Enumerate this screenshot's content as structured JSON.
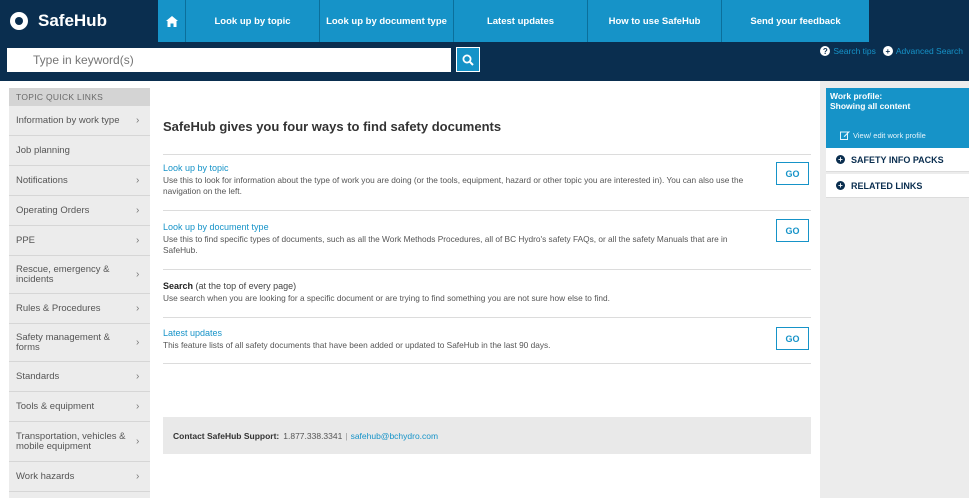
{
  "header": {
    "brand": "SafeHub",
    "nav": [
      "Look up by topic",
      "Look up by document type",
      "Latest updates",
      "How to use SafeHub",
      "Send your feedback"
    ]
  },
  "search": {
    "placeholder": "Type in keyword(s)",
    "tips_label": "Search tips",
    "advanced_label": "Advanced Search"
  },
  "sidebar": {
    "header": "TOPIC QUICK LINKS",
    "items": [
      "Information by work type",
      "Job planning",
      "Notifications",
      "Operating Orders",
      "PPE",
      "Rescue, emergency & incidents",
      "Rules & Procedures",
      "Safety management & forms",
      "Standards",
      "Tools & equipment",
      "Transportation, vehicles & mobile equipment",
      "Work hazards"
    ]
  },
  "main": {
    "title": "SafeHub gives you four ways to find safety documents",
    "sections": [
      {
        "title": "Look up by topic",
        "desc": "Use this to look for information about the type of work you are doing (or the tools, equipment, hazard or other topic you are interested in). You can also use the navigation on the left.",
        "button": "GO"
      },
      {
        "title": "Look up by document type",
        "desc": "Use this to find specific types of documents, such as all the Work Methods Procedures, all of BC Hydro's safety FAQs, or all the safety Manuals that are in SafeHub.",
        "button": "GO"
      },
      {
        "title": "Search",
        "title_suffix": "(at the top of every page)",
        "desc": "Use search when you are looking for a specific document or are trying to find something you are not sure how else to find."
      },
      {
        "title": "Latest updates",
        "desc": "This feature lists of all safety documents that have been added or updated to SafeHub in the last 90 days.",
        "button": "GO"
      }
    ],
    "contact": {
      "label": "Contact SafeHub Support:",
      "phone": "1.877.338.3341",
      "separator": "|",
      "email": "safehub@bchydro.com"
    }
  },
  "rightpanel": {
    "work_profile_label": "Work profile:",
    "work_profile_value": "Showing all content",
    "edit_link": "View/ edit work profile",
    "items": [
      "SAFETY INFO PACKS",
      "RELATED LINKS"
    ]
  },
  "colors": {
    "navy": "#0a2e4f",
    "accent": "#1693c8",
    "sidebar_bg": "#ececec"
  }
}
